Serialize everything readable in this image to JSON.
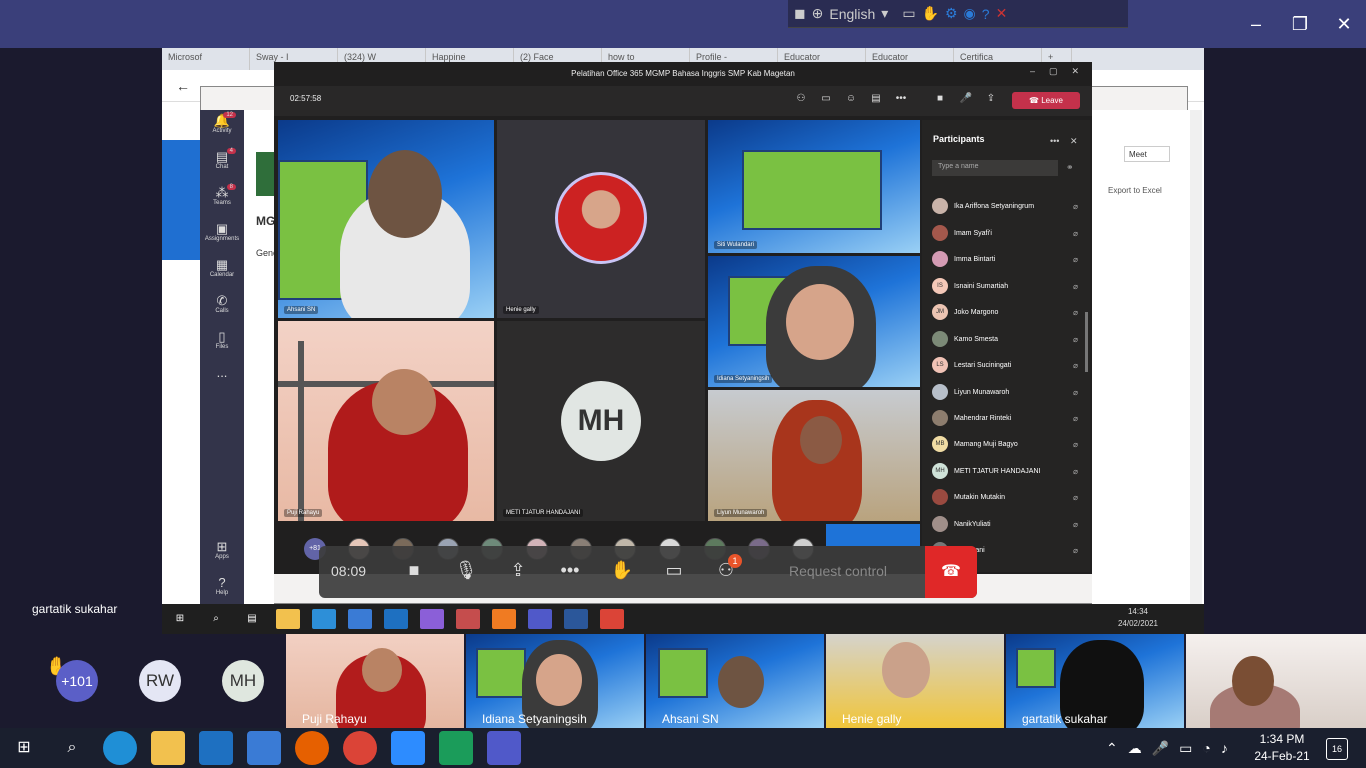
{
  "zoom_top": {
    "language": "English",
    "title_controls": [
      "–",
      "❐",
      "✕"
    ]
  },
  "browser": {
    "tabs": [
      "Microsof",
      "Sway - I",
      "(324) W",
      "Happine",
      "(2) Face",
      "how to",
      "Profile -",
      "Educator",
      "Educator",
      "Certifica"
    ],
    "new_tab": "+"
  },
  "teams_bg": {
    "rail": [
      {
        "label": "Activity",
        "icon": "bell-icon",
        "badge": "12"
      },
      {
        "label": "Chat",
        "icon": "chat-icon",
        "badge": "4"
      },
      {
        "label": "Teams",
        "icon": "teams-icon",
        "badge": "8"
      },
      {
        "label": "Assignments",
        "icon": "assignments-icon",
        "badge": ""
      },
      {
        "label": "Calendar",
        "icon": "calendar-icon",
        "badge": ""
      },
      {
        "label": "Calls",
        "icon": "phone-icon",
        "badge": ""
      },
      {
        "label": "Files",
        "icon": "file-icon",
        "badge": ""
      },
      {
        "label": "...",
        "icon": "more-icon",
        "badge": ""
      },
      {
        "label": "Apps",
        "icon": "apps-icon",
        "badge": ""
      },
      {
        "label": "Help",
        "icon": "help-icon",
        "badge": ""
      }
    ],
    "title_partial": "MGM",
    "subtitle_partial": "Gene",
    "meet_label": "Meet",
    "export_label": "Export to Excel"
  },
  "meeting": {
    "title": "Pelatihan Office 365 MGMP Bahasa Inggris SMP Kab Magetan",
    "timer": "02:57:58",
    "leave_label": "Leave",
    "tiles": [
      {
        "name": "Ahsani SN"
      },
      {
        "name": "Henie gally"
      },
      {
        "name": "Siti Wulandari"
      },
      {
        "name": "Idiana Setyaningsih"
      },
      {
        "name": "Puji Rahayu"
      },
      {
        "name": "METI TJATUR HANDAJANI",
        "initials": "MH"
      },
      {
        "name": "Liyun Munawaroh"
      }
    ],
    "overflow_count": "+81"
  },
  "participants": {
    "heading": "Participants",
    "search_placeholder": "Type a name",
    "people": [
      {
        "name": "Ika Ariffona Setyaningrum",
        "initials": ""
      },
      {
        "name": "Imam Syafi'i",
        "initials": ""
      },
      {
        "name": "Imma Bintarti",
        "initials": ""
      },
      {
        "name": "Isnaini Sumartiah",
        "initials": "IS"
      },
      {
        "name": "Joko Margono",
        "initials": "JM"
      },
      {
        "name": "Kamo Smesta",
        "initials": ""
      },
      {
        "name": "Lestari Suciningati",
        "initials": "LS"
      },
      {
        "name": "Liyun Munawaroh",
        "initials": ""
      },
      {
        "name": "Mahendrar Rinteki",
        "initials": ""
      },
      {
        "name": "Mamang Muji Bagyo",
        "initials": "MB"
      },
      {
        "name": "METI TJATUR HANDAJANI",
        "initials": "MH"
      },
      {
        "name": "Mutakin Mutakin",
        "initials": ""
      },
      {
        "name": "NanikYuliati",
        "initials": ""
      },
      {
        "name": "...Setiyani",
        "initials": ""
      }
    ]
  },
  "zoom_controls": {
    "timer": "08:09",
    "participants_badge": "1",
    "request_control": "Request control"
  },
  "screen_share_user": "gartatik sukahar",
  "inner_taskbar": {
    "time": "14:34",
    "date": "24/02/2021"
  },
  "gallery": {
    "raised_hands": "+101",
    "avatars": [
      "RW",
      "MH"
    ],
    "tiles": [
      "Puji Rahayu",
      "Idiana Setyaningsih",
      "Ahsani SN",
      "Henie gally",
      "gartatik sukahar"
    ]
  },
  "taskbar": {
    "time": "1:34 PM",
    "date": "24-Feb-21",
    "notifications": "16"
  },
  "colors": {
    "leave": "#c4314b",
    "end_call": "#e02828",
    "zoom_top": "#3a3f7a",
    "banner_green": "#7ac142"
  }
}
